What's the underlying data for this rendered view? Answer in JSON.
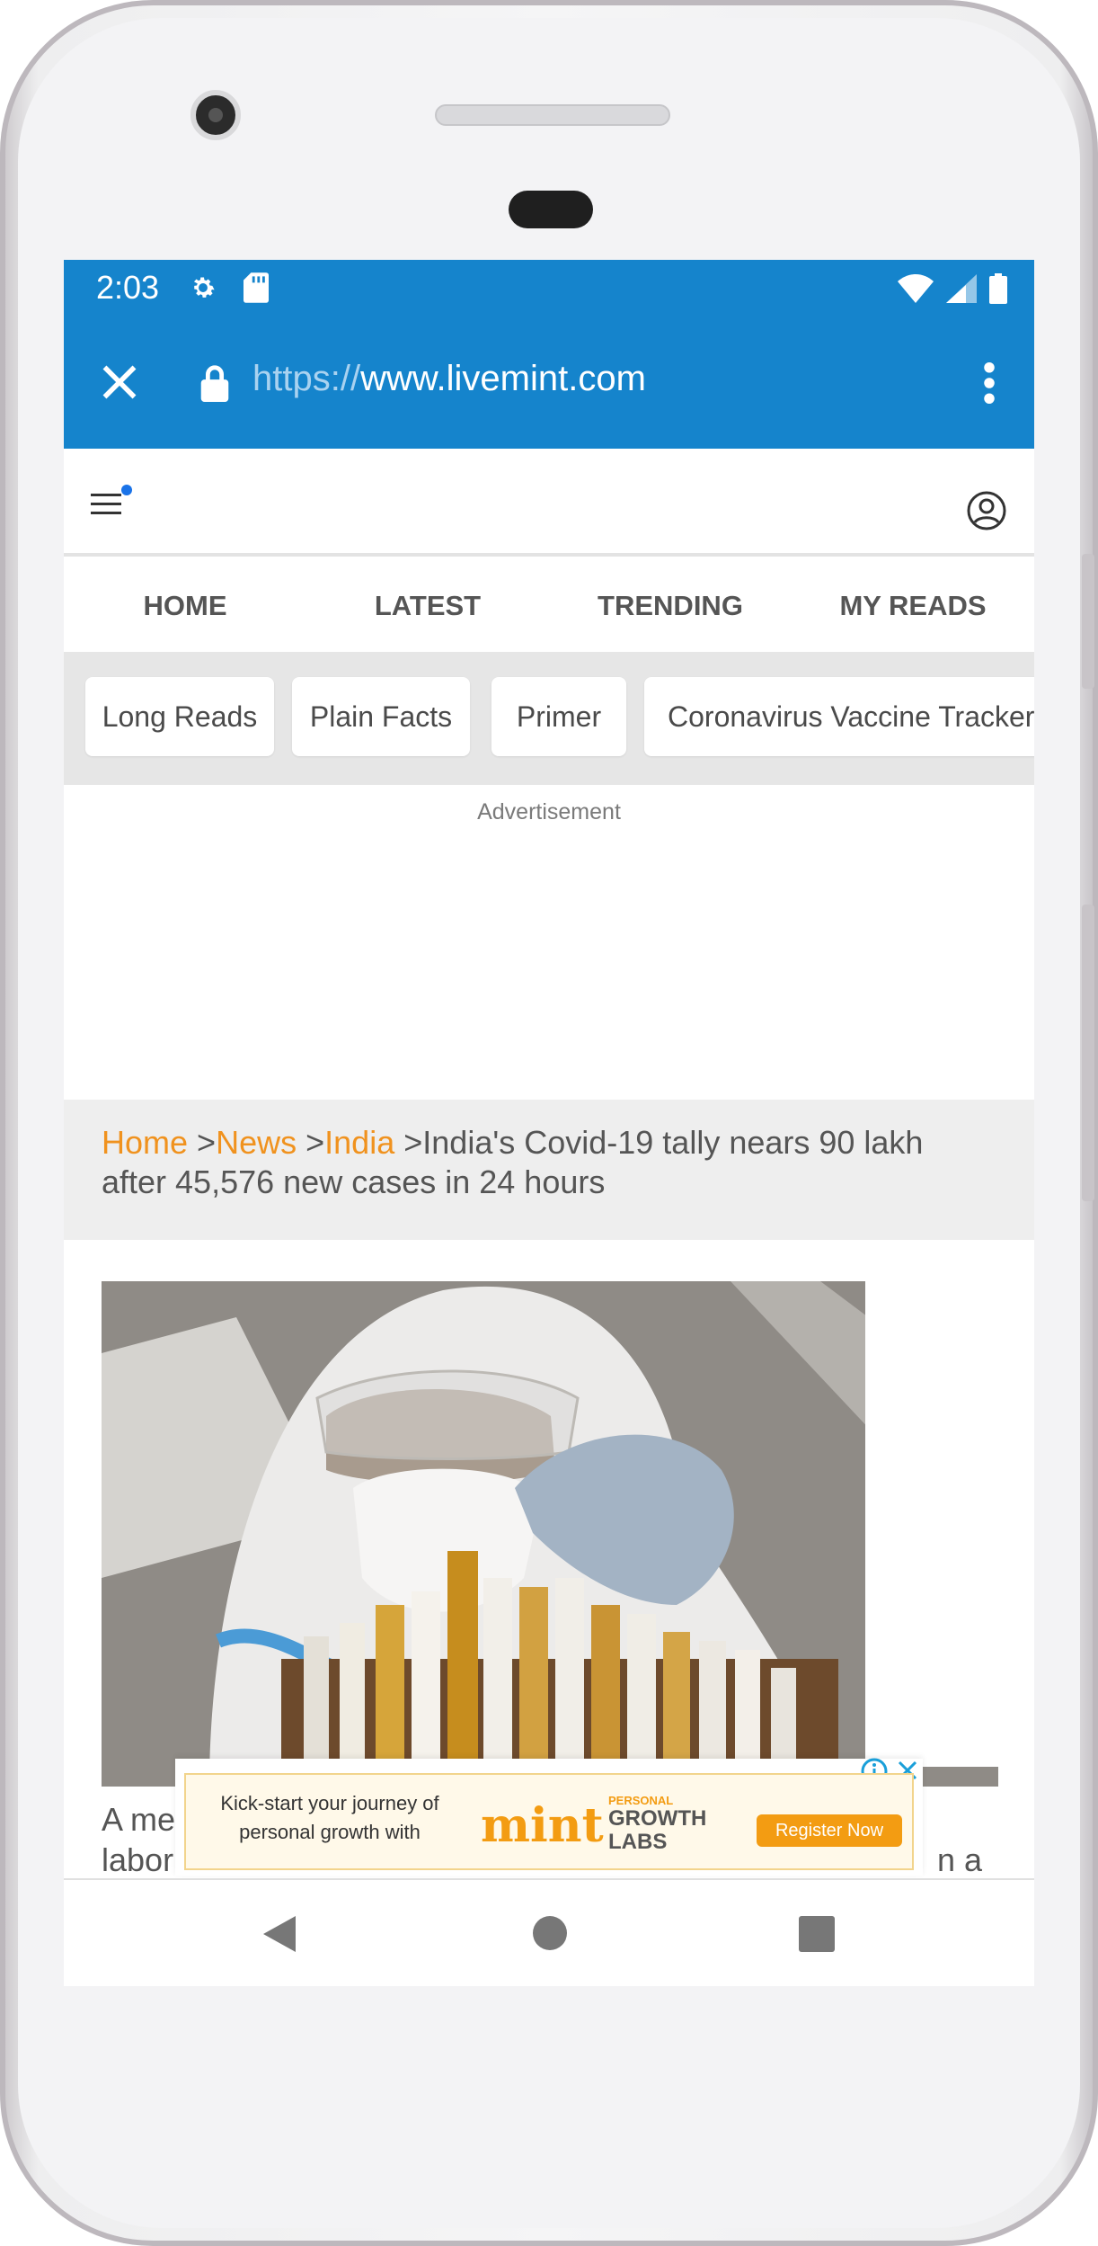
{
  "status_bar": {
    "time": "2:03"
  },
  "browser": {
    "url_protocol": "https://",
    "url_domain": "www.livemint.com"
  },
  "nav": {
    "items": [
      "HOME",
      "LATEST",
      "TRENDING",
      "MY READS"
    ]
  },
  "chips": [
    "Long Reads",
    "Plain Facts",
    "Primer",
    "Coronavirus Vaccine Tracker"
  ],
  "ad": {
    "label": "Advertisement"
  },
  "breadcrumb": {
    "home": "Home",
    "news": "News",
    "india": "India",
    "sep": ">",
    "title": "India's Covid-19 tally nears 90 lakh after 45,576 new cases in 24 hours"
  },
  "article": {
    "caption_line1_start": "A me",
    "caption_line1_end": "n a",
    "caption_line2": "labor"
  },
  "banner": {
    "text": "Kick-start your journey of personal growth with",
    "logo": "mint",
    "sub_line1": "PERSONAL",
    "sub_line2": "GROWTH",
    "sub_line3": "LABS",
    "button": "Register Now"
  },
  "colors": {
    "accent": "#1584cc",
    "link": "#f0921e"
  }
}
